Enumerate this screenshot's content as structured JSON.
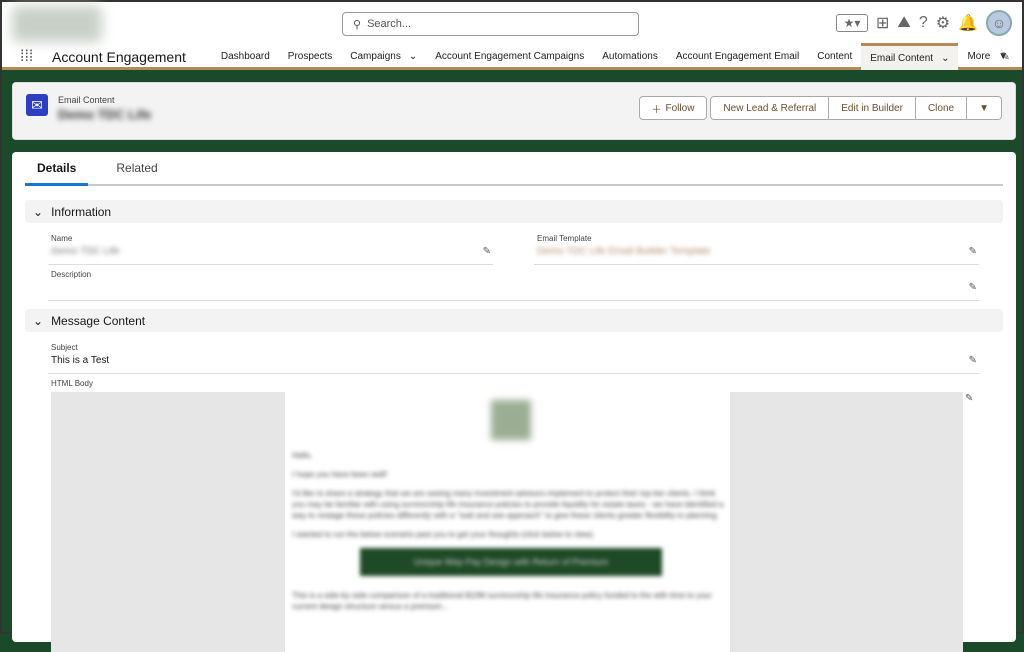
{
  "header": {
    "search_placeholder": "Search...",
    "app_name": "Account Engagement",
    "nav": [
      {
        "label": "Dashboard"
      },
      {
        "label": "Prospects"
      },
      {
        "label": "Campaigns",
        "dropdown": true
      },
      {
        "label": "Account Engagement Campaigns"
      },
      {
        "label": "Automations"
      },
      {
        "label": "Account Engagement Email"
      },
      {
        "label": "Content"
      },
      {
        "label": "Email Content",
        "dropdown": true,
        "active": true
      },
      {
        "label": "More",
        "dropdown": true
      }
    ]
  },
  "record": {
    "object_label": "Email Content",
    "name": "Demo TDC Life",
    "buttons": {
      "follow": "Follow",
      "new_lead": "New Lead & Referral",
      "edit_builder": "Edit in Builder",
      "clone": "Clone"
    }
  },
  "tabs": {
    "details": "Details",
    "related": "Related"
  },
  "sections": {
    "information": "Information",
    "message": "Message Content"
  },
  "fields": {
    "name_label": "Name",
    "name_value": "Demo TDC Life",
    "template_label": "Email Template",
    "template_value": "Demo TDC Life Email Builder Template",
    "description_label": "Description",
    "subject_label": "Subject",
    "subject_value": "This is a Test",
    "html_label": "HTML Body"
  },
  "email": {
    "p1": "Hello,",
    "p2": "I hope you have been well!",
    "p3": "I'd like to share a strategy that we are seeing many investment advisors implement to protect their top-tier clients. I think you may be familiar with using survivorship life insurance policies to provide liquidity for estate taxes - we have identified a way to restage these policies differently with a \"wait and see approach\" to give these clients greater flexibility in planning.",
    "p4": "I wanted to run the below scenario past you to get your thoughts (click below to view).",
    "cta": "Unique Wep Pay Design with Return of Premium",
    "p5": "This is a side-by-side comparison of a traditional $10M survivorship life insurance policy funded to the with time to your current design structure versus a premium..."
  },
  "colors": {
    "accent": "#b28b57",
    "background": "#1b4a2a",
    "tab_active": "#1b76d2",
    "object_icon": "#2e3ec0"
  }
}
